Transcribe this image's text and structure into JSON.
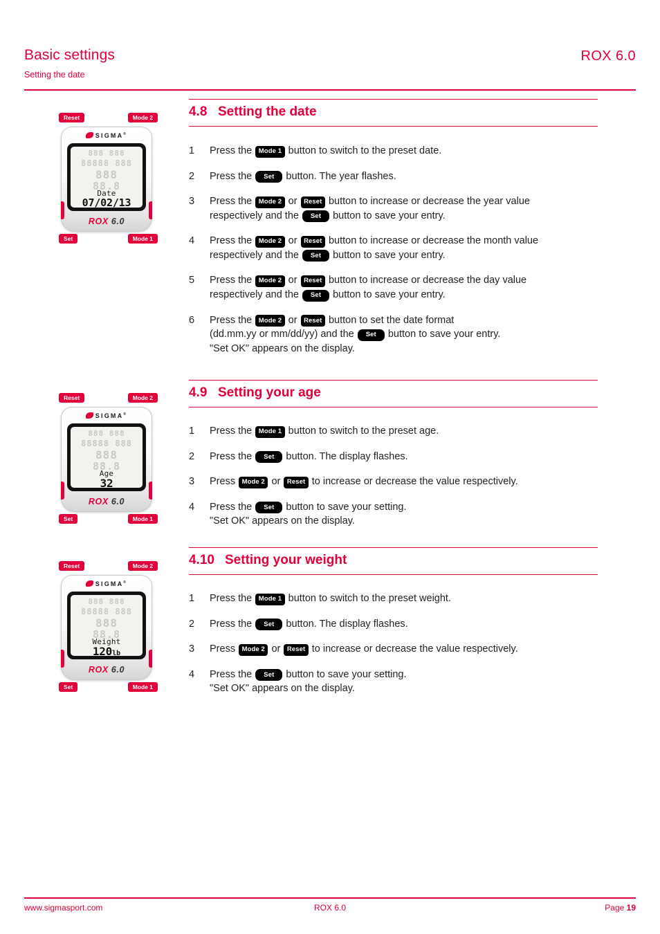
{
  "header": {
    "title": "Basic settings",
    "subtitle": "Setting the date",
    "model": "ROX 6.0"
  },
  "colors": {
    "brand_red": "#e2003b",
    "text_black": "#231f20",
    "badge_black": "#000000"
  },
  "buttons": {
    "mode1": "Mode 1",
    "mode2": "Mode 2",
    "reset": "Reset",
    "set": "Set"
  },
  "devices": [
    {
      "callout_top_left": "Reset",
      "callout_top_right": "Mode 2",
      "callout_bottom_left": "Set",
      "callout_bottom_right": "Mode 1",
      "brand": "SIGMA",
      "brand_mark": "ROX",
      "brand_version": "6.0",
      "screen_label": "Date",
      "screen_value": "07/02/13",
      "screen_unit": "",
      "ghost_row1": "888 888",
      "ghost_row2": "88888 888",
      "ghost_row3": "888",
      "ghost_row4": "88.8"
    },
    {
      "callout_top_left": "Reset",
      "callout_top_right": "Mode 2",
      "callout_bottom_left": "Set",
      "callout_bottom_right": "Mode 1",
      "brand": "SIGMA",
      "brand_mark": "ROX",
      "brand_version": "6.0",
      "screen_label": "Age",
      "screen_value": "32",
      "screen_unit": "",
      "ghost_row1": "888 888",
      "ghost_row2": "88888 888",
      "ghost_row3": "888",
      "ghost_row4": "88.8"
    },
    {
      "callout_top_left": "Reset",
      "callout_top_right": "Mode 2",
      "callout_bottom_left": "Set",
      "callout_bottom_right": "Mode 1",
      "brand": "SIGMA",
      "brand_mark": "ROX",
      "brand_version": "6.0",
      "screen_label": "Weight",
      "screen_value": "120",
      "screen_unit": "lb",
      "ghost_row1": "888 888",
      "ghost_row2": "88888 888",
      "ghost_row3": "888",
      "ghost_row4": "88.8"
    }
  ],
  "sections": [
    {
      "number": "4.8",
      "title": "Setting the date",
      "steps": [
        {
          "num": "1",
          "lines": [
            [
              {
                "t": "text",
                "v": "Press the "
              },
              {
                "t": "badge",
                "v": "Mode 1"
              },
              {
                "t": "text",
                "v": " button to switch to the preset date."
              }
            ]
          ]
        },
        {
          "num": "2",
          "lines": [
            [
              {
                "t": "text",
                "v": "Press the "
              },
              {
                "t": "badge-set",
                "v": "Set"
              },
              {
                "t": "text",
                "v": " button. The year flashes."
              }
            ]
          ]
        },
        {
          "num": "3",
          "lines": [
            [
              {
                "t": "text",
                "v": "Press the "
              },
              {
                "t": "badge",
                "v": "Mode 2"
              },
              {
                "t": "text",
                "v": " or "
              },
              {
                "t": "badge",
                "v": "Reset"
              },
              {
                "t": "text",
                "v": " button to increase or decrease the year value"
              }
            ],
            [
              {
                "t": "text",
                "v": "respectively and the "
              },
              {
                "t": "badge-set",
                "v": "Set"
              },
              {
                "t": "text",
                "v": " button to save your entry."
              }
            ]
          ]
        },
        {
          "num": "4",
          "lines": [
            [
              {
                "t": "text",
                "v": "Press the "
              },
              {
                "t": "badge",
                "v": "Mode 2"
              },
              {
                "t": "text",
                "v": " or "
              },
              {
                "t": "badge",
                "v": "Reset"
              },
              {
                "t": "text",
                "v": " button to increase or decrease the month value"
              }
            ],
            [
              {
                "t": "text",
                "v": "respectively and the "
              },
              {
                "t": "badge-set",
                "v": "Set"
              },
              {
                "t": "text",
                "v": " button to save your entry."
              }
            ]
          ]
        },
        {
          "num": "5",
          "lines": [
            [
              {
                "t": "text",
                "v": "Press the "
              },
              {
                "t": "badge",
                "v": "Mode 2"
              },
              {
                "t": "text",
                "v": " or "
              },
              {
                "t": "badge",
                "v": "Reset"
              },
              {
                "t": "text",
                "v": " button to increase or decrease the day value"
              }
            ],
            [
              {
                "t": "text",
                "v": "respectively and the "
              },
              {
                "t": "badge-set",
                "v": "Set"
              },
              {
                "t": "text",
                "v": " button to save your entry."
              }
            ]
          ]
        },
        {
          "num": "6",
          "lines": [
            [
              {
                "t": "text",
                "v": "Press the "
              },
              {
                "t": "badge",
                "v": "Mode 2"
              },
              {
                "t": "text",
                "v": " or "
              },
              {
                "t": "badge",
                "v": "Reset"
              },
              {
                "t": "text",
                "v": " button to set the date format"
              }
            ],
            [
              {
                "t": "text",
                "v": "(dd.mm.yy or mm/dd/yy) and the "
              },
              {
                "t": "badge-set",
                "v": "Set"
              },
              {
                "t": "text",
                "v": " button to save your entry."
              }
            ],
            [
              {
                "t": "text",
                "v": "\"Set OK\" appears on the display."
              }
            ]
          ]
        }
      ]
    },
    {
      "number": "4.9",
      "title": "Setting your age",
      "steps": [
        {
          "num": "1",
          "lines": [
            [
              {
                "t": "text",
                "v": "Press the "
              },
              {
                "t": "badge",
                "v": "Mode 1"
              },
              {
                "t": "text",
                "v": " button to switch to the preset age."
              }
            ]
          ]
        },
        {
          "num": "2",
          "lines": [
            [
              {
                "t": "text",
                "v": "Press the "
              },
              {
                "t": "badge-set",
                "v": "Set"
              },
              {
                "t": "text",
                "v": " button. The display flashes."
              }
            ]
          ]
        },
        {
          "num": "3",
          "lines": [
            [
              {
                "t": "text",
                "v": "Press "
              },
              {
                "t": "badge",
                "v": "Mode 2"
              },
              {
                "t": "text",
                "v": " or "
              },
              {
                "t": "badge",
                "v": "Reset"
              },
              {
                "t": "text",
                "v": " to increase or decrease the value respectively."
              }
            ]
          ]
        },
        {
          "num": "4",
          "lines": [
            [
              {
                "t": "text",
                "v": "Press the "
              },
              {
                "t": "badge-set",
                "v": "Set"
              },
              {
                "t": "text",
                "v": " button to save your setting."
              }
            ],
            [
              {
                "t": "text",
                "v": "\"Set OK\" appears on the display."
              }
            ]
          ]
        }
      ]
    },
    {
      "number": "4.10",
      "title": "Setting your weight",
      "steps": [
        {
          "num": "1",
          "lines": [
            [
              {
                "t": "text",
                "v": "Press the "
              },
              {
                "t": "badge",
                "v": "Mode 1"
              },
              {
                "t": "text",
                "v": " button to switch to the preset weight."
              }
            ]
          ]
        },
        {
          "num": "2",
          "lines": [
            [
              {
                "t": "text",
                "v": "Press the "
              },
              {
                "t": "badge-set",
                "v": "Set"
              },
              {
                "t": "text",
                "v": " button. The display flashes."
              }
            ]
          ]
        },
        {
          "num": "3",
          "lines": [
            [
              {
                "t": "text",
                "v": "Press "
              },
              {
                "t": "badge",
                "v": "Mode 2"
              },
              {
                "t": "text",
                "v": " or "
              },
              {
                "t": "badge",
                "v": "Reset"
              },
              {
                "t": "text",
                "v": " to increase or decrease the value respectively."
              }
            ]
          ]
        },
        {
          "num": "4",
          "lines": [
            [
              {
                "t": "text",
                "v": "Press the "
              },
              {
                "t": "badge-set",
                "v": "Set"
              },
              {
                "t": "text",
                "v": " button to save your setting."
              }
            ],
            [
              {
                "t": "text",
                "v": "\"Set OK\" appears on the display."
              }
            ]
          ]
        }
      ]
    }
  ],
  "footer": {
    "website": "www.sigmasport.com",
    "model": "ROX 6.0",
    "page_label": "Page ",
    "page_number": "19"
  }
}
